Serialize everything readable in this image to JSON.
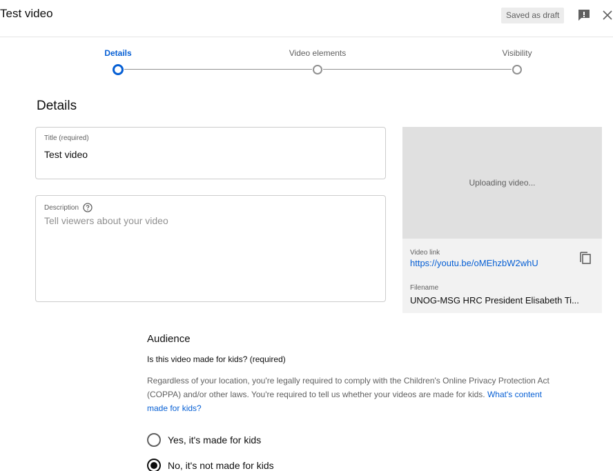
{
  "header": {
    "title": "Test video",
    "draft_status": "Saved as draft",
    "feedback_icon": "feedback-icon",
    "close_icon": "close-icon"
  },
  "steps": [
    {
      "label": "Details",
      "active": true
    },
    {
      "label": "Video elements",
      "active": false
    },
    {
      "label": "Visibility",
      "active": false
    }
  ],
  "details": {
    "section_title": "Details",
    "title_field": {
      "label": "Title (required)",
      "value": "Test video"
    },
    "description_field": {
      "label": "Description",
      "placeholder": "Tell viewers about your video",
      "help_icon": "help-icon"
    }
  },
  "video_panel": {
    "status": "Uploading video...",
    "video_link_label": "Video link",
    "video_link": "https://youtu.be/oMEhzbW2whU",
    "copy_icon": "copy-icon",
    "filename_label": "Filename",
    "filename": "UNOG-MSG HRC President Elisabeth Ti..."
  },
  "audience": {
    "title": "Audience",
    "question": "Is this video made for kids? (required)",
    "explanation": "Regardless of your location, you're legally required to comply with the Children's Online Privacy Protection Act (COPPA) and/or other laws. You're required to tell us whether your videos are made for kids. ",
    "link_text": "What's content made for kids?",
    "options": [
      {
        "label": "Yes, it's made for kids",
        "selected": false
      },
      {
        "label": "No, it's not made for kids",
        "selected": true
      }
    ]
  },
  "colors": {
    "accent": "#065fd4",
    "text_primary": "#0d0d0d",
    "text_secondary": "#606060"
  }
}
